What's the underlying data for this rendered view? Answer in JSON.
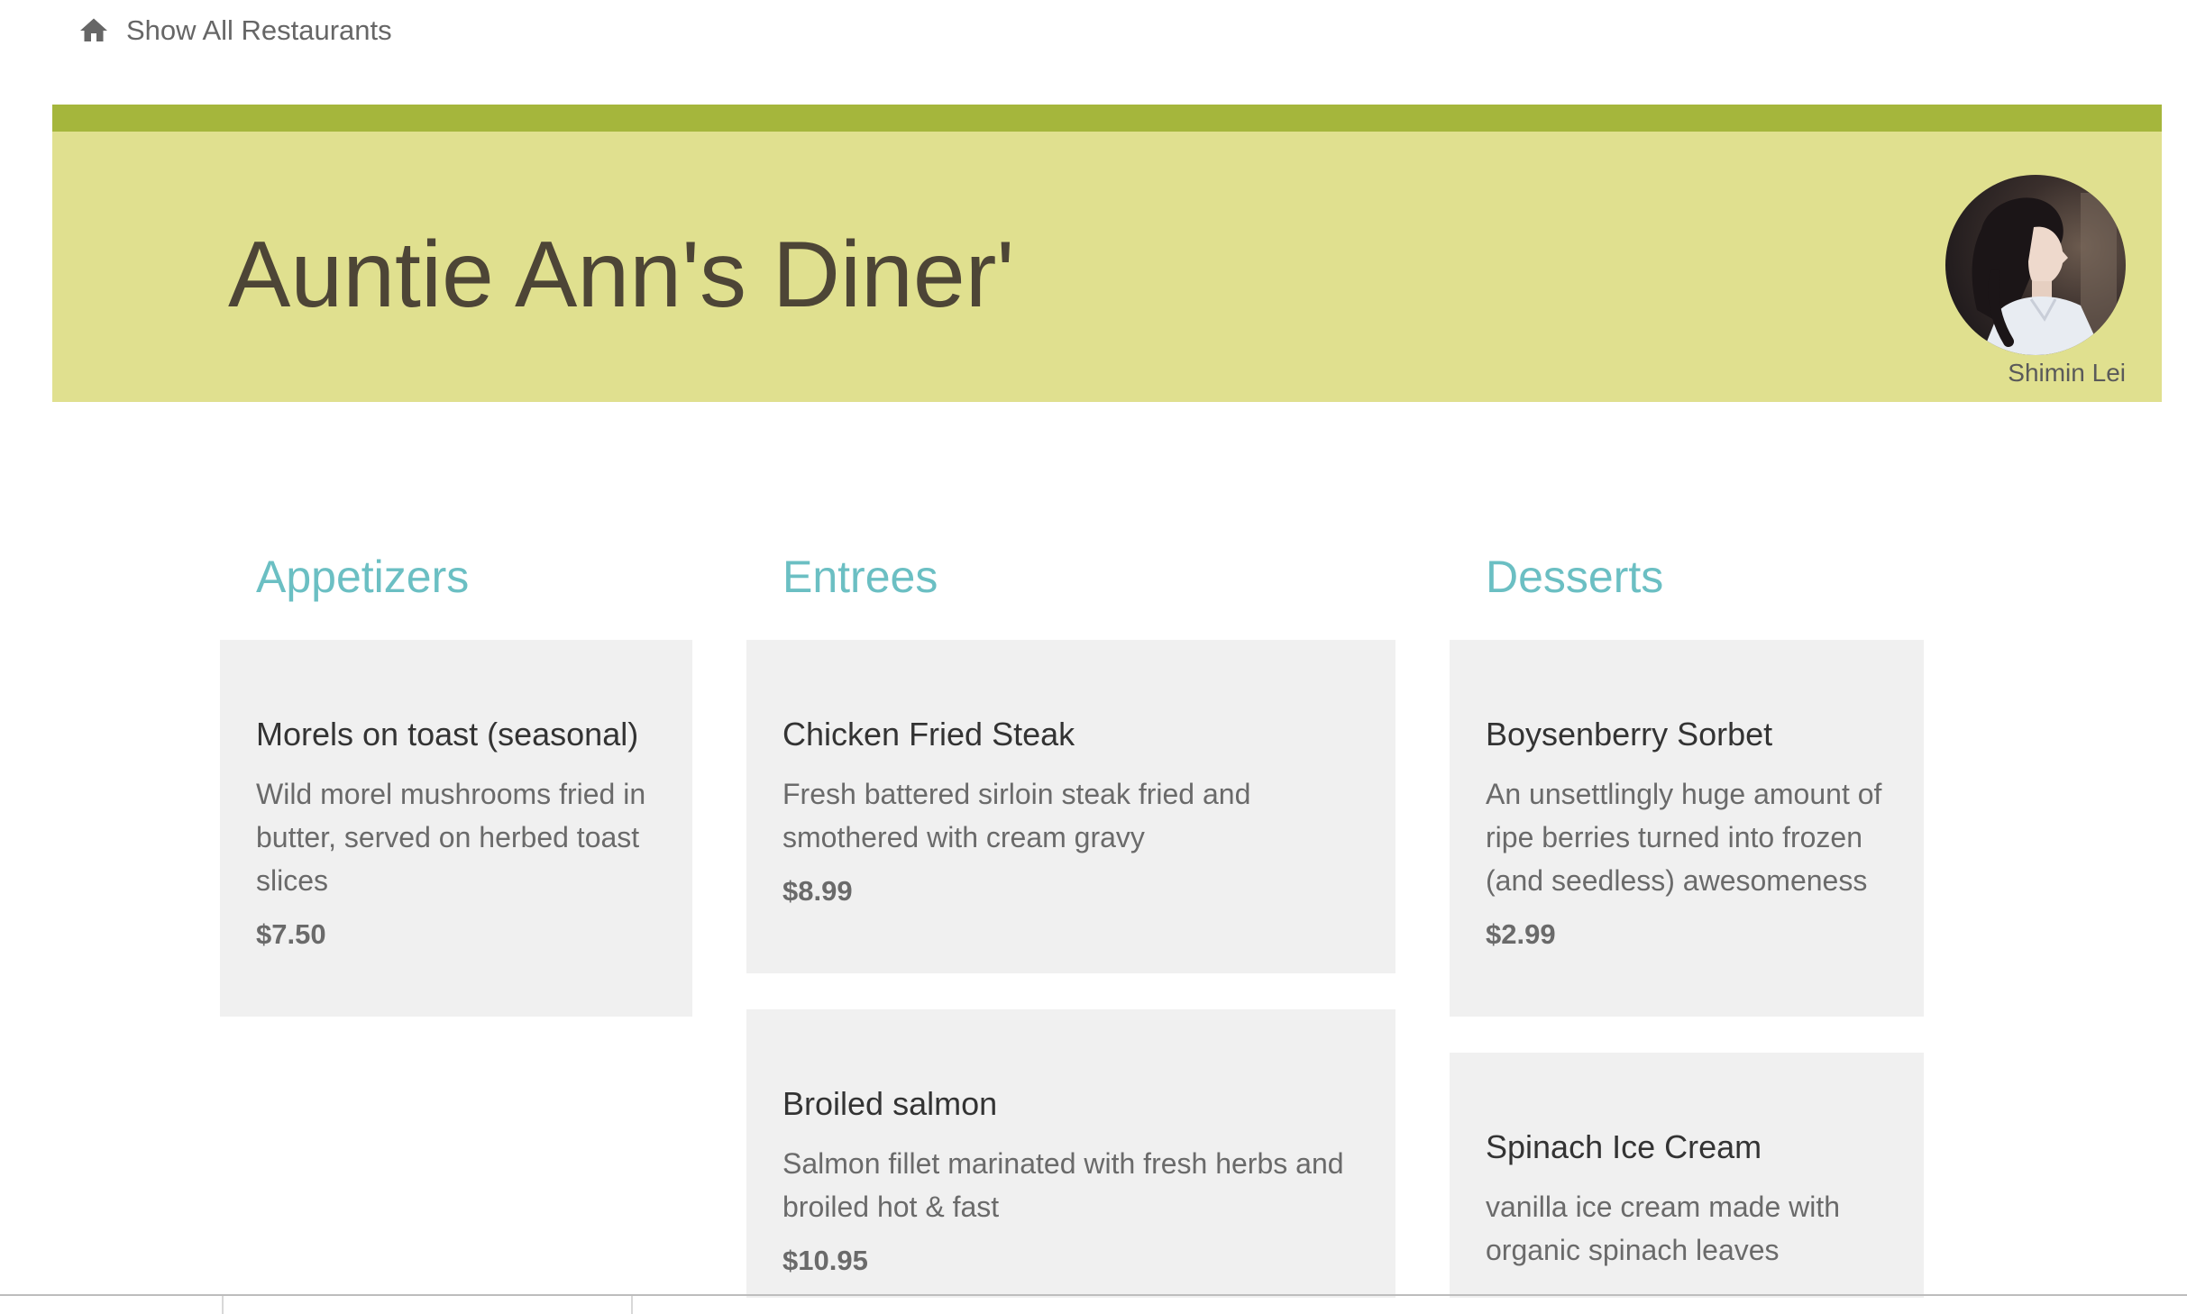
{
  "nav": {
    "icon": "home-icon",
    "label": "Show All Restaurants"
  },
  "header": {
    "title": "Auntie Ann's Diner'",
    "user_name": "Shimin Lei",
    "colors": {
      "banner": "#e0e08f",
      "bar": "#a5b63c",
      "title": "#4d4536"
    }
  },
  "menu": {
    "accent_color": "#6bbfc3",
    "columns": [
      {
        "title": "Appetizers",
        "items": [
          {
            "name": "Morels on toast (seasonal)",
            "description": "Wild morel mushrooms fried in butter, served on herbed toast slices",
            "price": "$7.50"
          }
        ]
      },
      {
        "title": "Entrees",
        "items": [
          {
            "name": "Chicken Fried Steak",
            "description": "Fresh battered sirloin steak fried and smothered with cream gravy",
            "price": "$8.99"
          },
          {
            "name": "Broiled salmon",
            "description": "Salmon fillet marinated with fresh herbs and broiled hot & fast",
            "price": "$10.95"
          }
        ]
      },
      {
        "title": "Desserts",
        "items": [
          {
            "name": "Boysenberry Sorbet",
            "description": "An unsettlingly huge amount of ripe berries turned into frozen (and seedless) awesomeness",
            "price": "$2.99"
          },
          {
            "name": "Spinach Ice Cream",
            "description": "vanilla ice cream made with organic spinach leaves",
            "price": ""
          }
        ]
      }
    ]
  }
}
